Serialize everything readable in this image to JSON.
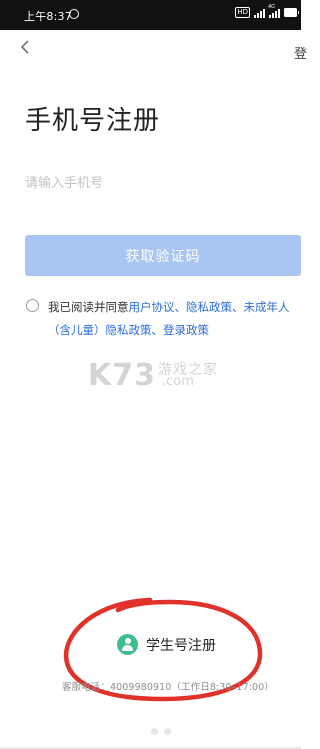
{
  "status_bar": {
    "time": "上午8:37",
    "hd": "HD",
    "network": "4G"
  },
  "header": {
    "top_right_link": "登"
  },
  "main": {
    "title": "手机号注册",
    "phone_placeholder": "请输入手机号",
    "get_code_button": "获取验证码"
  },
  "agreement": {
    "prefix": "我已阅读并同意",
    "user_agreement": "用户协议",
    "sep1": "、",
    "privacy_policy": "隐私政策",
    "sep2": "、",
    "minor_line1": "未成年人",
    "minor_line2": "（含儿童）隐私政策",
    "sep3": "、",
    "login_policy": "登录政策"
  },
  "watermark": {
    "logo": "K73",
    "text": "游戏之家",
    "domain": ".com"
  },
  "student": {
    "label": "学生号注册"
  },
  "footer": {
    "service_line": "客服电话：4009980910（工作日8:30–17:00）"
  },
  "colors": {
    "link": "#2d6fd8",
    "button_disabled": "#a9c5f1",
    "student_icon": "#3dbf8c",
    "annotation_circle": "#e0322a"
  }
}
